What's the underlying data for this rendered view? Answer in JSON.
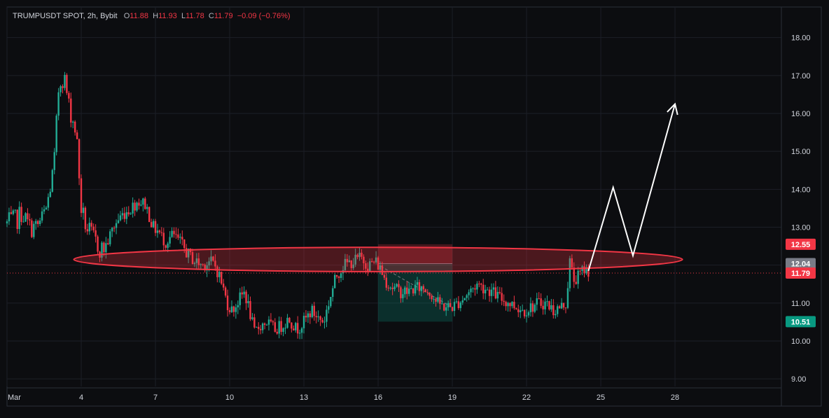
{
  "header": {
    "symbol": "TRUMPUSDT SPOT, 2h, Bybit",
    "o_label": "O",
    "o_value": "11.88",
    "h_label": "H",
    "h_value": "11.93",
    "l_label": "L",
    "l_value": "11.78",
    "c_label": "C",
    "c_value": "11.79",
    "change": "−0.09 (−0.76%)"
  },
  "colors": {
    "background": "#0c0d10",
    "grid": "#1c1f27",
    "up": "#22ab94",
    "down": "#f23645",
    "axis_text": "#d1d4dc",
    "ellipse": "#f23645",
    "arrow": "#ffffff"
  },
  "chart_data": {
    "type": "candlestick",
    "y_axis": {
      "ticks": [
        "18.00",
        "17.00",
        "16.00",
        "15.00",
        "14.00",
        "13.00",
        "12.00",
        "11.00",
        "10.00",
        "9.00"
      ],
      "ylim": [
        8.8,
        18.4
      ],
      "position": "right"
    },
    "x_axis": {
      "ticks": [
        "Mar",
        "4",
        "7",
        "10",
        "13",
        "16",
        "19",
        "22",
        "25",
        "28"
      ],
      "tick_days": [
        1,
        4,
        7,
        10,
        13,
        16,
        19,
        22,
        25,
        28
      ],
      "xlim": [
        1,
        32.3
      ]
    },
    "grid": true,
    "price_labels": [
      {
        "value": 12.55,
        "text": "12.55",
        "color": "#f23645"
      },
      {
        "value": 12.04,
        "text": "12.04",
        "color": "#787b86"
      },
      {
        "value": 11.79,
        "text": "11.79",
        "color": "#f23645"
      },
      {
        "value": 10.51,
        "text": "10.51",
        "color": "#089981"
      }
    ],
    "last_price": 11.79,
    "position_tool": {
      "start_day": 16.0,
      "end_day": 19.0,
      "entry": 12.04,
      "stop": 12.55,
      "target": 10.51
    },
    "zone_ellipse": {
      "center_day": 16.0,
      "center_price": 12.15,
      "half_width_days": 12.3,
      "half_height_price": 0.32
    },
    "projection_path": [
      {
        "day": 24.5,
        "price": 11.85
      },
      {
        "day": 25.5,
        "price": 14.05
      },
      {
        "day": 26.3,
        "price": 12.25
      },
      {
        "day": 28.0,
        "price": 16.25
      }
    ],
    "candles_anchor": [
      [
        1.0,
        13.1
      ],
      [
        1.4,
        13.2
      ],
      [
        1.6,
        13.4
      ],
      [
        1.9,
        13.0
      ],
      [
        2.2,
        13.0
      ],
      [
        2.4,
        13.2
      ],
      [
        2.6,
        13.5
      ],
      [
        2.9,
        14.6
      ],
      [
        3.1,
        16.8
      ],
      [
        3.3,
        17.0
      ],
      [
        3.5,
        16.2
      ],
      [
        3.8,
        15.5
      ],
      [
        4.0,
        13.5
      ],
      [
        4.2,
        13.0
      ],
      [
        4.5,
        12.7
      ],
      [
        4.8,
        12.4
      ],
      [
        5.0,
        12.5
      ],
      [
        5.3,
        13.0
      ],
      [
        5.6,
        13.3
      ],
      [
        6.0,
        13.5
      ],
      [
        6.3,
        13.7
      ],
      [
        6.6,
        13.6
      ],
      [
        6.9,
        13.0
      ],
      [
        7.1,
        12.9
      ],
      [
        7.4,
        12.6
      ],
      [
        7.7,
        12.8
      ],
      [
        8.0,
        12.6
      ],
      [
        8.3,
        12.3
      ],
      [
        8.6,
        12.1
      ],
      [
        8.9,
        12.0
      ],
      [
        9.2,
        12.1
      ],
      [
        9.4,
        12.0
      ],
      [
        9.6,
        11.7
      ],
      [
        9.9,
        11.0
      ],
      [
        10.1,
        10.8
      ],
      [
        10.4,
        11.1
      ],
      [
        10.6,
        11.3
      ],
      [
        10.8,
        10.8
      ],
      [
        11.0,
        10.2
      ],
      [
        11.2,
        10.4
      ],
      [
        11.5,
        10.5
      ],
      [
        11.8,
        10.3
      ],
      [
        12.1,
        10.4
      ],
      [
        12.4,
        10.6
      ],
      [
        12.7,
        10.3
      ],
      [
        13.0,
        10.5
      ],
      [
        13.3,
        10.8
      ],
      [
        13.6,
        10.6
      ],
      [
        13.8,
        10.5
      ],
      [
        14.0,
        11.0
      ],
      [
        14.3,
        11.7
      ],
      [
        14.6,
        12.0
      ],
      [
        15.0,
        12.1
      ],
      [
        15.3,
        12.2
      ],
      [
        15.6,
        12.0
      ],
      [
        15.9,
        12.1
      ],
      [
        16.1,
        11.9
      ],
      [
        16.3,
        11.6
      ],
      [
        16.6,
        11.4
      ],
      [
        16.9,
        11.3
      ],
      [
        17.2,
        11.3
      ],
      [
        17.5,
        11.4
      ],
      [
        17.8,
        11.4
      ],
      [
        18.1,
        11.3
      ],
      [
        18.4,
        11.0
      ],
      [
        18.7,
        10.9
      ],
      [
        19.0,
        10.9
      ],
      [
        19.4,
        11.1
      ],
      [
        19.7,
        11.3
      ],
      [
        20.0,
        11.5
      ],
      [
        20.3,
        11.4
      ],
      [
        20.6,
        11.3
      ],
      [
        21.0,
        11.1
      ],
      [
        21.3,
        11.0
      ],
      [
        21.6,
        10.9
      ],
      [
        21.9,
        10.8
      ],
      [
        22.2,
        10.9
      ],
      [
        22.5,
        11.0
      ],
      [
        22.8,
        11.0
      ],
      [
        23.1,
        10.8
      ],
      [
        23.4,
        10.9
      ],
      [
        23.6,
        11.0
      ],
      [
        23.75,
        12.1
      ],
      [
        23.9,
        11.6
      ],
      [
        24.1,
        11.7
      ],
      [
        24.3,
        11.9
      ],
      [
        24.5,
        11.85
      ]
    ]
  }
}
